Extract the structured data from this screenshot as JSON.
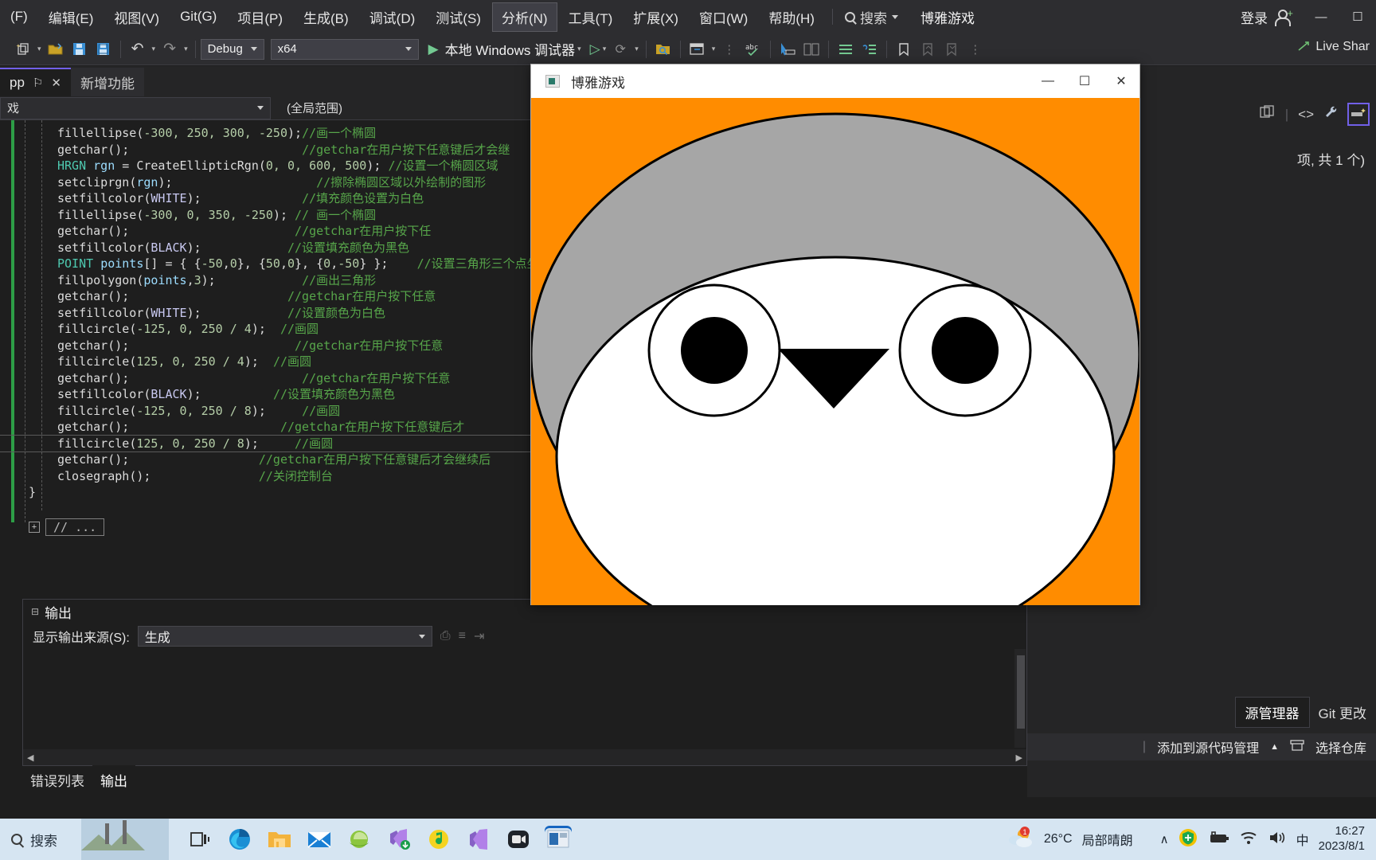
{
  "menubar": {
    "items": [
      {
        "label": "(F)",
        "active": false
      },
      {
        "label": "编辑(E)",
        "active": false
      },
      {
        "label": "视图(V)",
        "active": false
      },
      {
        "label": "Git(G)",
        "active": false
      },
      {
        "label": "项目(P)",
        "active": false
      },
      {
        "label": "生成(B)",
        "active": false
      },
      {
        "label": "调试(D)",
        "active": false
      },
      {
        "label": "测试(S)",
        "active": false
      },
      {
        "label": "分析(N)",
        "active": true
      },
      {
        "label": "工具(T)",
        "active": false
      },
      {
        "label": "扩展(X)",
        "active": false
      },
      {
        "label": "窗口(W)",
        "active": false
      },
      {
        "label": "帮助(H)",
        "active": false
      }
    ],
    "search_label": "搜索",
    "solution_name": "博雅游戏",
    "login_label": "登录",
    "min_glyph": "—",
    "max_glyph": "☐"
  },
  "toolbar": {
    "config": "Debug",
    "platform": "x64",
    "run_label": "本地 Windows 调试器",
    "live_share": "Live Shar",
    "undo_glyph": "↶",
    "redo_glyph": "↷",
    "play_glyph": "▶",
    "abc_label": "abc"
  },
  "tabs": [
    {
      "label": "pp",
      "active": true,
      "pin": "⚐",
      "close": "✕"
    },
    {
      "label": "新增功能",
      "active": false
    }
  ],
  "navbar": {
    "left_scope": "戏",
    "right_scope": "(全局范围)"
  },
  "editor": {
    "collapsed_region": "// ...",
    "lines": [
      {
        "indent": 2,
        "tokens": [
          {
            "t": "fillellipse",
            "c": "c-plain"
          },
          {
            "t": "(",
            "c": "c-punc"
          },
          {
            "t": "-300, 250, 300, -250",
            "c": "c-num"
          },
          {
            "t": ");",
            "c": "c-punc"
          },
          {
            "t": "//画一个椭圆",
            "c": "c-cmt"
          }
        ]
      },
      {
        "indent": 2,
        "tokens": [
          {
            "t": "getchar",
            "c": "c-plain"
          },
          {
            "t": "();",
            "c": "c-punc"
          },
          {
            "t": "                        ",
            "c": "c-plain"
          },
          {
            "t": "//getchar在用户按下任意键后才会继",
            "c": "c-cmt"
          }
        ]
      },
      {
        "indent": 2,
        "tokens": [
          {
            "t": "HRGN",
            "c": "c-type"
          },
          {
            "t": " ",
            "c": "c-plain"
          },
          {
            "t": "rgn",
            "c": "c-var"
          },
          {
            "t": " = ",
            "c": "c-punc"
          },
          {
            "t": "CreateEllipticRgn",
            "c": "c-plain"
          },
          {
            "t": "(",
            "c": "c-punc"
          },
          {
            "t": "0, 0, 600, 500",
            "c": "c-num"
          },
          {
            "t": "); ",
            "c": "c-punc"
          },
          {
            "t": "//设置一个椭圆区域",
            "c": "c-cmt"
          }
        ]
      },
      {
        "indent": 2,
        "tokens": [
          {
            "t": "setcliprgn",
            "c": "c-plain"
          },
          {
            "t": "(",
            "c": "c-punc"
          },
          {
            "t": "rgn",
            "c": "c-var"
          },
          {
            "t": ");",
            "c": "c-punc"
          },
          {
            "t": "                    ",
            "c": "c-plain"
          },
          {
            "t": "//擦除椭圆区域以外绘制的图形",
            "c": "c-cmt"
          }
        ]
      },
      {
        "indent": 2,
        "tokens": [
          {
            "t": "setfillcolor",
            "c": "c-plain"
          },
          {
            "t": "(",
            "c": "c-punc"
          },
          {
            "t": "WHITE",
            "c": "c-macro"
          },
          {
            "t": ");",
            "c": "c-punc"
          },
          {
            "t": "              ",
            "c": "c-plain"
          },
          {
            "t": "//填充颜色设置为白色",
            "c": "c-cmt"
          }
        ]
      },
      {
        "indent": 2,
        "tokens": [
          {
            "t": "fillellipse",
            "c": "c-plain"
          },
          {
            "t": "(",
            "c": "c-punc"
          },
          {
            "t": "-300, 0, 350, -250",
            "c": "c-num"
          },
          {
            "t": "); ",
            "c": "c-punc"
          },
          {
            "t": "// 画一个椭圆",
            "c": "c-cmt"
          }
        ]
      },
      {
        "indent": 2,
        "tokens": [
          {
            "t": "getchar",
            "c": "c-plain"
          },
          {
            "t": "();",
            "c": "c-punc"
          },
          {
            "t": "                       ",
            "c": "c-plain"
          },
          {
            "t": "//getchar在用户按下任",
            "c": "c-cmt"
          }
        ]
      },
      {
        "indent": 2,
        "tokens": [
          {
            "t": "setfillcolor",
            "c": "c-plain"
          },
          {
            "t": "(",
            "c": "c-punc"
          },
          {
            "t": "BLACK",
            "c": "c-macro"
          },
          {
            "t": ");",
            "c": "c-punc"
          },
          {
            "t": "            ",
            "c": "c-plain"
          },
          {
            "t": "//设置填充颜色为黑色",
            "c": "c-cmt"
          }
        ]
      },
      {
        "indent": 2,
        "tokens": [
          {
            "t": "POINT",
            "c": "c-type"
          },
          {
            "t": " ",
            "c": "c-plain"
          },
          {
            "t": "points",
            "c": "c-var"
          },
          {
            "t": "[] = { {",
            "c": "c-punc"
          },
          {
            "t": "-50",
            "c": "c-num"
          },
          {
            "t": ",",
            "c": "c-punc"
          },
          {
            "t": "0",
            "c": "c-num"
          },
          {
            "t": "}, {",
            "c": "c-punc"
          },
          {
            "t": "50",
            "c": "c-num"
          },
          {
            "t": ",",
            "c": "c-punc"
          },
          {
            "t": "0",
            "c": "c-num"
          },
          {
            "t": "}, {",
            "c": "c-punc"
          },
          {
            "t": "0",
            "c": "c-num"
          },
          {
            "t": ",",
            "c": "c-punc"
          },
          {
            "t": "-50",
            "c": "c-num"
          },
          {
            "t": "} };    ",
            "c": "c-punc"
          },
          {
            "t": "//设置三角形三个点坐",
            "c": "c-cmt"
          }
        ]
      },
      {
        "indent": 2,
        "tokens": [
          {
            "t": "fillpolygon",
            "c": "c-plain"
          },
          {
            "t": "(",
            "c": "c-punc"
          },
          {
            "t": "points",
            "c": "c-var"
          },
          {
            "t": ",",
            "c": "c-punc"
          },
          {
            "t": "3",
            "c": "c-num"
          },
          {
            "t": ");",
            "c": "c-punc"
          },
          {
            "t": "            ",
            "c": "c-plain"
          },
          {
            "t": "//画出三角形",
            "c": "c-cmt"
          }
        ]
      },
      {
        "indent": 2,
        "tokens": [
          {
            "t": "getchar",
            "c": "c-plain"
          },
          {
            "t": "();",
            "c": "c-punc"
          },
          {
            "t": "                      ",
            "c": "c-plain"
          },
          {
            "t": "//getchar在用户按下任意",
            "c": "c-cmt"
          }
        ]
      },
      {
        "indent": 2,
        "tokens": [
          {
            "t": "setfillcolor",
            "c": "c-plain"
          },
          {
            "t": "(",
            "c": "c-punc"
          },
          {
            "t": "WHITE",
            "c": "c-macro"
          },
          {
            "t": ");",
            "c": "c-punc"
          },
          {
            "t": "            ",
            "c": "c-plain"
          },
          {
            "t": "//设置颜色为白色",
            "c": "c-cmt"
          }
        ]
      },
      {
        "indent": 2,
        "tokens": [
          {
            "t": "fillcircle",
            "c": "c-plain"
          },
          {
            "t": "(",
            "c": "c-punc"
          },
          {
            "t": "-125, 0, 250 / 4",
            "c": "c-num"
          },
          {
            "t": ");  ",
            "c": "c-punc"
          },
          {
            "t": "//画圆",
            "c": "c-cmt"
          }
        ]
      },
      {
        "indent": 2,
        "tokens": [
          {
            "t": "getchar",
            "c": "c-plain"
          },
          {
            "t": "();",
            "c": "c-punc"
          },
          {
            "t": "                       ",
            "c": "c-plain"
          },
          {
            "t": "//getchar在用户按下任意",
            "c": "c-cmt"
          }
        ]
      },
      {
        "indent": 2,
        "tokens": [
          {
            "t": "fillcircle",
            "c": "c-plain"
          },
          {
            "t": "(",
            "c": "c-punc"
          },
          {
            "t": "125, 0, 250 / 4",
            "c": "c-num"
          },
          {
            "t": ");  ",
            "c": "c-punc"
          },
          {
            "t": "//画圆",
            "c": "c-cmt"
          }
        ]
      },
      {
        "indent": 2,
        "tokens": [
          {
            "t": "getchar",
            "c": "c-plain"
          },
          {
            "t": "();",
            "c": "c-punc"
          },
          {
            "t": "                        ",
            "c": "c-plain"
          },
          {
            "t": "//getchar在用户按下任意",
            "c": "c-cmt"
          }
        ]
      },
      {
        "indent": 2,
        "tokens": [
          {
            "t": "setfillcolor",
            "c": "c-plain"
          },
          {
            "t": "(",
            "c": "c-punc"
          },
          {
            "t": "BLACK",
            "c": "c-macro"
          },
          {
            "t": ");",
            "c": "c-punc"
          },
          {
            "t": "          ",
            "c": "c-plain"
          },
          {
            "t": "//设置填充颜色为黑色",
            "c": "c-cmt"
          }
        ]
      },
      {
        "indent": 2,
        "tokens": [
          {
            "t": "fillcircle",
            "c": "c-plain"
          },
          {
            "t": "(",
            "c": "c-punc"
          },
          {
            "t": "-125, 0, 250 / 8",
            "c": "c-num"
          },
          {
            "t": ");     ",
            "c": "c-punc"
          },
          {
            "t": "//画圆",
            "c": "c-cmt"
          }
        ]
      },
      {
        "indent": 2,
        "tokens": [
          {
            "t": "getchar",
            "c": "c-plain"
          },
          {
            "t": "();",
            "c": "c-punc"
          },
          {
            "t": "                     ",
            "c": "c-plain"
          },
          {
            "t": "//getchar在用户按下任意键后才",
            "c": "c-cmt"
          }
        ]
      },
      {
        "indent": 2,
        "highlight": true,
        "tokens": [
          {
            "t": "fillcircle",
            "c": "c-plain"
          },
          {
            "t": "(",
            "c": "c-punc"
          },
          {
            "t": "125, 0, 250 / 8",
            "c": "c-num"
          },
          {
            "t": ");     ",
            "c": "c-punc"
          },
          {
            "t": "//画圆",
            "c": "c-cmt"
          }
        ]
      },
      {
        "indent": 2,
        "tokens": [
          {
            "t": "getchar",
            "c": "c-plain"
          },
          {
            "t": "();",
            "c": "c-punc"
          },
          {
            "t": "                  ",
            "c": "c-plain"
          },
          {
            "t": "//getchar在用户按下任意键后才会继续后",
            "c": "c-cmt"
          }
        ]
      },
      {
        "indent": 2,
        "tokens": [
          {
            "t": "closegraph",
            "c": "c-plain"
          },
          {
            "t": "();",
            "c": "c-punc"
          },
          {
            "t": "               ",
            "c": "c-plain"
          },
          {
            "t": "//关闭控制台",
            "c": "c-cmt"
          }
        ]
      },
      {
        "indent": 0,
        "tokens": [
          {
            "t": "}",
            "c": "c-punc"
          }
        ]
      }
    ]
  },
  "output_pane": {
    "title": "输出",
    "source_label": "显示输出来源(S):",
    "source_value": "生成",
    "scroll_left_glyph": "◀",
    "scroll_right_glyph": "▶"
  },
  "bottom_tabs": [
    {
      "label": "错误列表",
      "active": false
    },
    {
      "label": "输出",
      "active": true
    }
  ],
  "right_dock": {
    "count_text": "项, 共 1 个)",
    "tabs": [
      {
        "label": "源管理器",
        "active": true
      },
      {
        "label": "Git 更改",
        "active": false
      }
    ],
    "status_add_source": "添加到源代码管理",
    "status_select_repo": "选择仓库",
    "caret_up_glyph": "▲"
  },
  "app_window": {
    "title": "博雅游戏",
    "min_glyph": "—",
    "max_glyph": "☐",
    "close_glyph": "✕",
    "canvas": {
      "background_color": "#ff8c00",
      "head_color": "#a6a6a6",
      "belly_color": "#ffffff",
      "eye_white_color": "#ffffff",
      "pupil_color": "#000000",
      "beak_color": "#000000",
      "outline_color": "#000000"
    }
  },
  "taskbar": {
    "search_label": "搜索",
    "weather_temp": "26°C",
    "weather_desc": "局部晴朗",
    "ime_label": "中",
    "time": "16:27",
    "date": "2023/8/1",
    "chevron_up_glyph": "∧",
    "icons": [
      "task-view-icon",
      "edge-icon",
      "file-explorer-icon",
      "mail-icon",
      "ie-icon",
      "vs-installer-icon",
      "qq-music-icon",
      "visual-studio-icon",
      "camera-icon",
      "active-app-icon"
    ]
  }
}
